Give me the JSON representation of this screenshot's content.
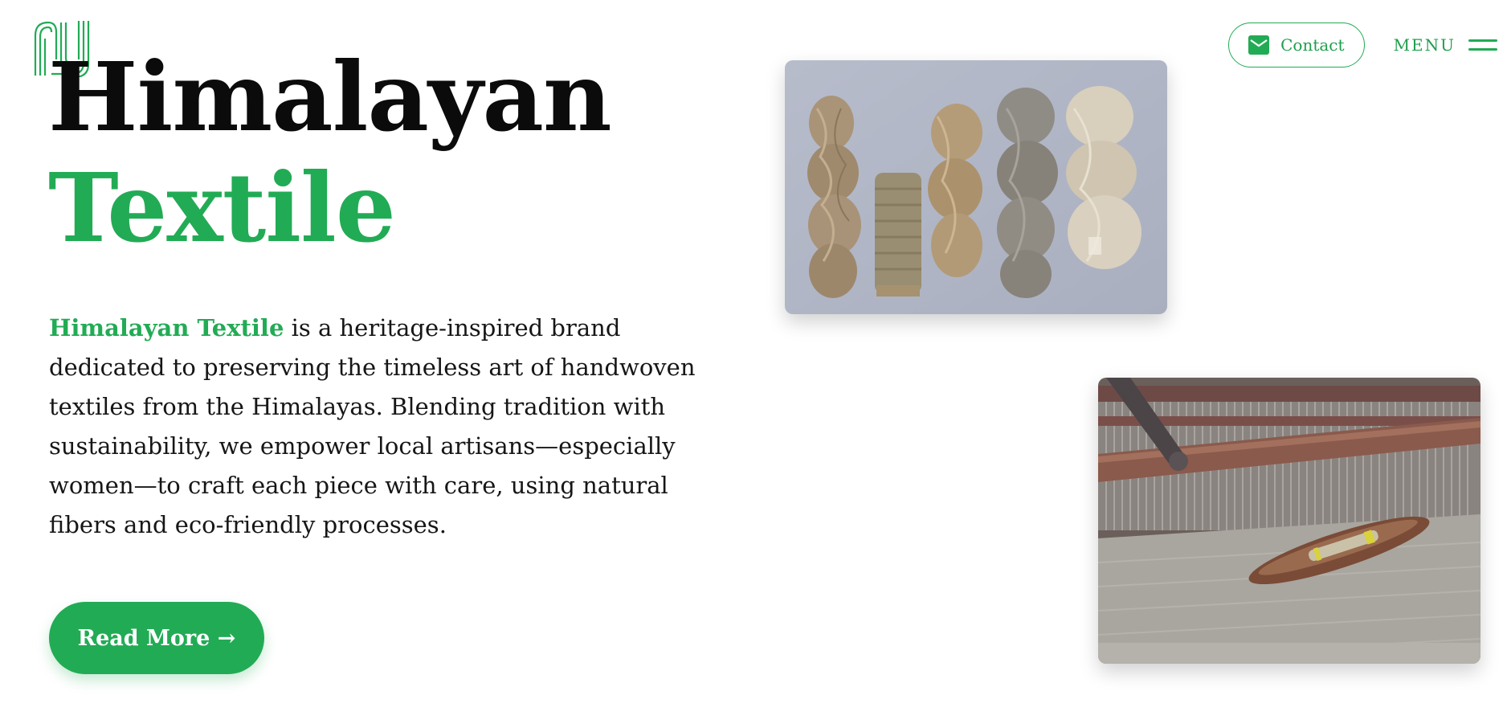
{
  "brand": {
    "logo": "hj-monogram-logo",
    "accent_color": "#22ab55"
  },
  "header": {
    "contact_label": "Contact",
    "contact_icon": "mail-icon",
    "menu_label": "MENU",
    "menu_icon": "hamburger-icon"
  },
  "hero": {
    "title_line1": "Himalayan",
    "title_line2": "Textile",
    "intro_brand": "Himalayan Textile",
    "intro_text": " is a heritage-inspired brand dedicated to preserving the timeless art of handwoven textiles from the Himalayas. Blending tradition with sustainability, we empower local artisans—especially women—to craft each piece with care, using natural fibers and eco-friendly processes.",
    "cta_label": "Read More →"
  },
  "images": [
    {
      "name": "yarn-skeins-photo"
    },
    {
      "name": "handloom-shuttle-photo"
    }
  ]
}
